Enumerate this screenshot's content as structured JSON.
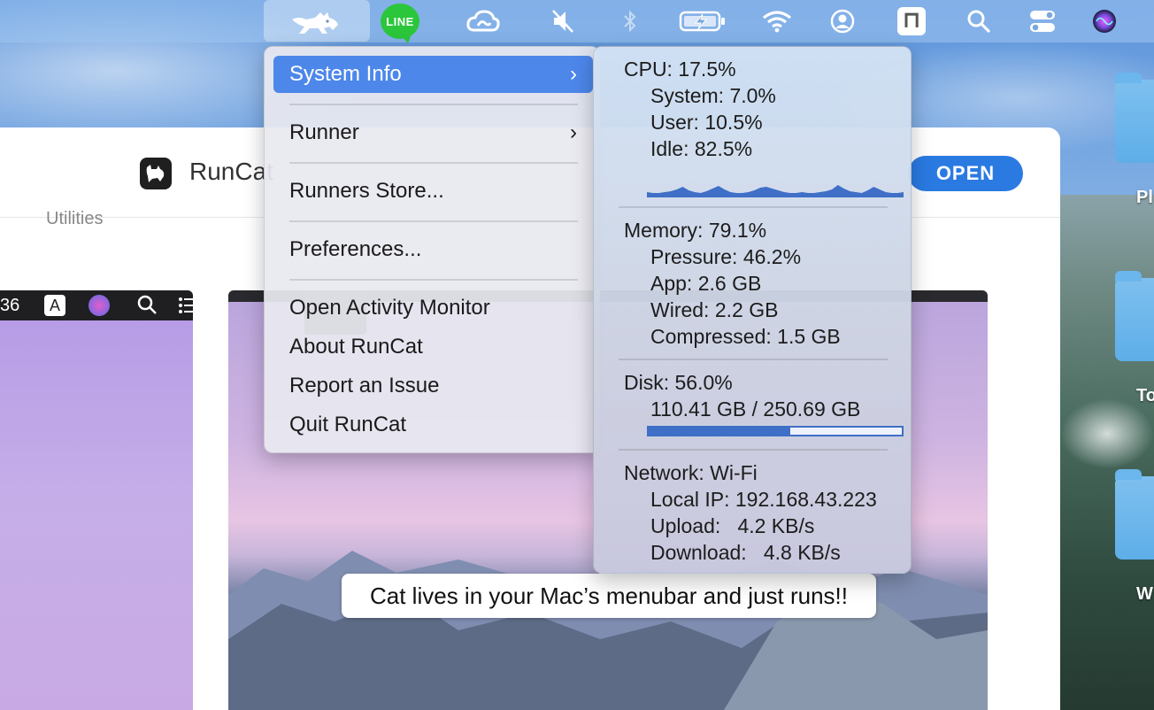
{
  "menubar": {
    "line_label": "LINE"
  },
  "app": {
    "name": "RunCat",
    "category": "Utilities",
    "open_label": "OPEN",
    "caption": "Cat lives in your Mac’s menubar and just runs!!",
    "left_shot_clock": "36"
  },
  "desktop": {
    "folder_labels": [
      "Pl",
      "To",
      "W"
    ]
  },
  "menu": {
    "items": [
      {
        "label": "System Info",
        "submenu": true,
        "highlighted": true
      },
      {
        "label": "Runner",
        "submenu": true
      },
      {
        "label": "Runners Store..."
      },
      {
        "label": "Preferences..."
      },
      {
        "label": "Open Activity Monitor"
      },
      {
        "label": "About RunCat"
      },
      {
        "label": "Report an Issue"
      },
      {
        "label": "Quit RunCat"
      }
    ]
  },
  "system_info": {
    "cpu": {
      "header": "CPU: 17.5%",
      "system": "System: 7.0%",
      "user": "User: 10.5%",
      "idle": "Idle: 82.5%",
      "usage_history": [
        6,
        5,
        5,
        6,
        7,
        9,
        12,
        8,
        6,
        5,
        7,
        10,
        13,
        9,
        6,
        5,
        5,
        6,
        8,
        11,
        12,
        10,
        8,
        6,
        5,
        5,
        6,
        5,
        5,
        6,
        7,
        9,
        14,
        10,
        7,
        6,
        5,
        8,
        12,
        9,
        6,
        5,
        5,
        6
      ]
    },
    "memory": {
      "header": "Memory: 79.1%",
      "pressure": "Pressure: 46.2%",
      "app": "App: 2.6 GB",
      "wired": "Wired: 2.2 GB",
      "compressed": "Compressed: 1.5 GB"
    },
    "disk": {
      "header": "Disk: 56.0%",
      "usage": "110.41 GB / 250.69 GB",
      "used_fraction": 0.56
    },
    "network": {
      "header": "Network: Wi-Fi",
      "local_ip": "Local IP: 192.168.43.223",
      "upload": "Upload:   4.2 KB/s",
      "download": "Download:   4.8 KB/s"
    }
  },
  "colors": {
    "menu_highlight": "#4d87ea",
    "open_button": "#2a7ae2",
    "graph_fill": "#3f6fc7",
    "line_green": "#2bc63b"
  }
}
